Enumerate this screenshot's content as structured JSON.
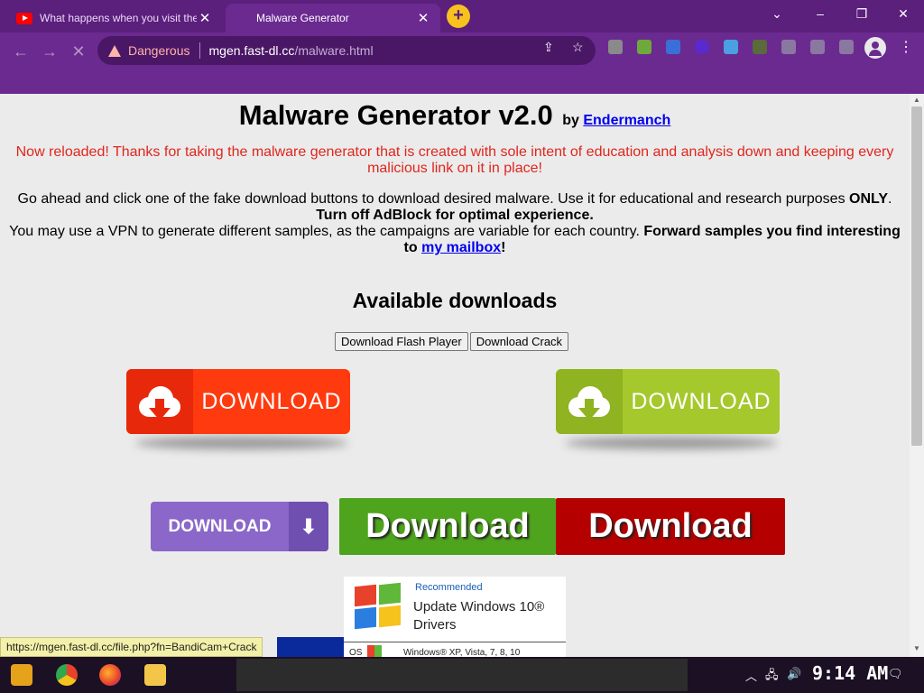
{
  "tabs": [
    {
      "title": "What happens when you visit the",
      "active": false
    },
    {
      "title": "Malware Generator",
      "active": true
    }
  ],
  "omnibox": {
    "security_label": "Dangerous",
    "host": "mgen.fast-dl.cc",
    "path": "/malware.html"
  },
  "page": {
    "title": "Malware Generator v2.0",
    "by": "by",
    "author": "Endermanch",
    "notice": "Now reloaded! Thanks for taking the malware generator that is created with sole intent of education and analysis down and keeping every malicious link on it in place!",
    "intro_line1": "Go ahead and click one of the fake download buttons to download desired malware. Use it for educational and research purposes",
    "intro_only": "ONLY",
    "intro_line2": "Turn off AdBlock for optimal experience.",
    "intro_line3": "You may use a VPN to generate different samples, as the campaigns are variable for each country.",
    "intro_forward": "Forward samples you find interesting to",
    "mailbox_link": "my mailbox",
    "bang": "!",
    "downloads_heading": "Available downloads",
    "small_buttons": [
      "Download Flash Player",
      "Download Crack"
    ],
    "download_red": "DOWNLOAD",
    "download_green": "DOWNLOAD",
    "download_purple": "DOWNLOAD",
    "download_big_green": "Download",
    "download_big_red": "Download",
    "ad": {
      "recommended": "Recommended",
      "message_line1": "Update Windows 10®",
      "message_line2": "Drivers",
      "os_label": "OS",
      "os_versions": "Windows® XP, Vista, 7, 8, 10"
    }
  },
  "status_url": "https://mgen.fast-dl.cc/file.php?fn=BandiCam+Crack",
  "taskbar": {
    "time": "9:14 AM"
  },
  "colors": {
    "chrome_theme": "#6a2a90",
    "dangerous": "#ffb4a8",
    "notice_red": "#e0261d",
    "link_blue": "#0000ee"
  }
}
